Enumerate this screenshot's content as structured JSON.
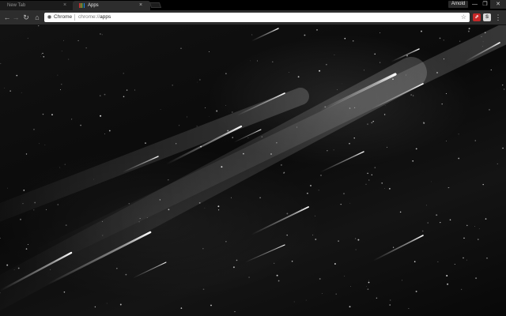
{
  "tabs": [
    {
      "title": "New Tab",
      "close_glyph": "×",
      "active": false
    },
    {
      "title": "Apps",
      "close_glyph": "×",
      "active": true,
      "favicon": "apps-grid-icon"
    }
  ],
  "profile": {
    "name": "Arnold"
  },
  "window_controls": {
    "minimize": "—",
    "maximize": "❐",
    "close": "✕"
  },
  "toolbar": {
    "back_glyph": "←",
    "forward_glyph": "→",
    "reload_glyph": "↻",
    "home_glyph": "⌂",
    "origin_label": "Chrome",
    "url_scheme": "chrome://",
    "url_path": "apps",
    "star_glyph": "☆",
    "menu_glyph": "⋮",
    "extensions": [
      {
        "name": "red-extension-icon",
        "glyph": "⇗",
        "color": "#c62828"
      },
      {
        "name": "s-extension-icon",
        "glyph": "S",
        "color": "#d9d9d9"
      }
    ]
  },
  "theme": {
    "tab_strip": "#000000",
    "toolbar": "#2d2d2d",
    "content_background": "#0a0a0a",
    "apps_favicon_colors": [
      "#e53935",
      "#fbc02d",
      "#43a047",
      "#1e88e5"
    ]
  },
  "content": {
    "background_image": "meteor-shower-night-sky"
  }
}
